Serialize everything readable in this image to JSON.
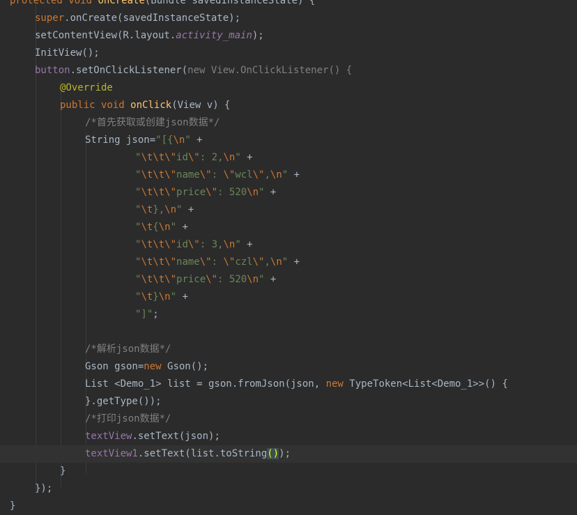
{
  "colors": {
    "background": "#2b2b2b",
    "current_line": "#323232",
    "keyword": "#cc7832",
    "method": "#ffc66d",
    "field": "#9876aa",
    "string": "#6a8759",
    "number": "#6897bb",
    "comment": "#808080",
    "annotation": "#bbb529",
    "plain": "#a9b7c6"
  },
  "code": {
    "lines": [
      {
        "indent": 0,
        "tokens": [
          {
            "t": "protected",
            "c": "kw"
          },
          {
            "t": " "
          },
          {
            "t": "void",
            "c": "kw"
          },
          {
            "t": " "
          },
          {
            "t": "onCreate",
            "c": "fn"
          },
          {
            "t": "(Bundle savedInstanceState) {"
          }
        ]
      },
      {
        "indent": 1,
        "tokens": [
          {
            "t": "super",
            "c": "kw"
          },
          {
            "t": ".onCreate(savedInstanceState);"
          }
        ]
      },
      {
        "indent": 1,
        "tokens": [
          {
            "t": "setContentView(R.layout."
          },
          {
            "t": "activity_main",
            "c": "it"
          },
          {
            "t": ");"
          }
        ]
      },
      {
        "indent": 1,
        "tokens": [
          {
            "t": "InitView();"
          }
        ]
      },
      {
        "indent": 1,
        "tokens": [
          {
            "t": "button",
            "c": "fld"
          },
          {
            "t": ".setOnClickListener("
          },
          {
            "t": "new",
            "c": "dim"
          },
          {
            "t": " View.OnClickListener() {",
            "c": "dim"
          }
        ]
      },
      {
        "indent": 2,
        "tokens": [
          {
            "t": "@Override",
            "c": "ann"
          }
        ]
      },
      {
        "indent": 2,
        "tokens": [
          {
            "t": "public",
            "c": "kw"
          },
          {
            "t": " "
          },
          {
            "t": "void",
            "c": "kw"
          },
          {
            "t": " "
          },
          {
            "t": "onClick",
            "c": "fn"
          },
          {
            "t": "(View v) {"
          }
        ]
      },
      {
        "indent": 3,
        "tokens": [
          {
            "t": "/*首先获取或创建json数据*/",
            "c": "cmt"
          }
        ]
      },
      {
        "indent": 3,
        "tokens": [
          {
            "t": "String json="
          },
          {
            "t": "\"[{",
            "c": "str"
          },
          {
            "t": "\\n",
            "c": "esc"
          },
          {
            "t": "\"",
            "c": "str"
          },
          {
            "t": " +"
          }
        ]
      },
      {
        "indent": 5,
        "tokens": [
          {
            "t": "\"",
            "c": "str"
          },
          {
            "t": "\\t\\t\\\"",
            "c": "esc"
          },
          {
            "t": "id",
            "c": "str"
          },
          {
            "t": "\\\"",
            "c": "esc"
          },
          {
            "t": ": 2,",
            "c": "str"
          },
          {
            "t": "\\n",
            "c": "esc"
          },
          {
            "t": "\"",
            "c": "str"
          },
          {
            "t": " +"
          }
        ]
      },
      {
        "indent": 5,
        "tokens": [
          {
            "t": "\"",
            "c": "str"
          },
          {
            "t": "\\t\\t\\\"",
            "c": "esc"
          },
          {
            "t": "name",
            "c": "str"
          },
          {
            "t": "\\\"",
            "c": "esc"
          },
          {
            "t": ": ",
            "c": "str"
          },
          {
            "t": "\\\"",
            "c": "esc"
          },
          {
            "t": "wcl",
            "c": "str"
          },
          {
            "t": "\\\"",
            "c": "esc"
          },
          {
            "t": ",",
            "c": "str"
          },
          {
            "t": "\\n",
            "c": "esc"
          },
          {
            "t": "\"",
            "c": "str"
          },
          {
            "t": " +"
          }
        ]
      },
      {
        "indent": 5,
        "tokens": [
          {
            "t": "\"",
            "c": "str"
          },
          {
            "t": "\\t\\t\\\"",
            "c": "esc"
          },
          {
            "t": "price",
            "c": "str"
          },
          {
            "t": "\\\"",
            "c": "esc"
          },
          {
            "t": ": 520",
            "c": "str"
          },
          {
            "t": "\\n",
            "c": "esc"
          },
          {
            "t": "\"",
            "c": "str"
          },
          {
            "t": " +"
          }
        ]
      },
      {
        "indent": 5,
        "tokens": [
          {
            "t": "\"",
            "c": "str"
          },
          {
            "t": "\\t",
            "c": "esc"
          },
          {
            "t": "},",
            "c": "str"
          },
          {
            "t": "\\n",
            "c": "esc"
          },
          {
            "t": "\"",
            "c": "str"
          },
          {
            "t": " +"
          }
        ]
      },
      {
        "indent": 5,
        "tokens": [
          {
            "t": "\"",
            "c": "str"
          },
          {
            "t": "\\t",
            "c": "esc"
          },
          {
            "t": "{",
            "c": "str"
          },
          {
            "t": "\\n",
            "c": "esc"
          },
          {
            "t": "\"",
            "c": "str"
          },
          {
            "t": " +"
          }
        ]
      },
      {
        "indent": 5,
        "tokens": [
          {
            "t": "\"",
            "c": "str"
          },
          {
            "t": "\\t\\t\\\"",
            "c": "esc"
          },
          {
            "t": "id",
            "c": "str"
          },
          {
            "t": "\\\"",
            "c": "esc"
          },
          {
            "t": ": 3,",
            "c": "str"
          },
          {
            "t": "\\n",
            "c": "esc"
          },
          {
            "t": "\"",
            "c": "str"
          },
          {
            "t": " +"
          }
        ]
      },
      {
        "indent": 5,
        "tokens": [
          {
            "t": "\"",
            "c": "str"
          },
          {
            "t": "\\t\\t\\\"",
            "c": "esc"
          },
          {
            "t": "name",
            "c": "str"
          },
          {
            "t": "\\\"",
            "c": "esc"
          },
          {
            "t": ": ",
            "c": "str"
          },
          {
            "t": "\\\"",
            "c": "esc"
          },
          {
            "t": "czl",
            "c": "str"
          },
          {
            "t": "\\\"",
            "c": "esc"
          },
          {
            "t": ",",
            "c": "str"
          },
          {
            "t": "\\n",
            "c": "esc"
          },
          {
            "t": "\"",
            "c": "str"
          },
          {
            "t": " +"
          }
        ]
      },
      {
        "indent": 5,
        "tokens": [
          {
            "t": "\"",
            "c": "str"
          },
          {
            "t": "\\t\\t\\\"",
            "c": "esc"
          },
          {
            "t": "price",
            "c": "str"
          },
          {
            "t": "\\\"",
            "c": "esc"
          },
          {
            "t": ": 520",
            "c": "str"
          },
          {
            "t": "\\n",
            "c": "esc"
          },
          {
            "t": "\"",
            "c": "str"
          },
          {
            "t": " +"
          }
        ]
      },
      {
        "indent": 5,
        "tokens": [
          {
            "t": "\"",
            "c": "str"
          },
          {
            "t": "\\t",
            "c": "esc"
          },
          {
            "t": "}",
            "c": "str"
          },
          {
            "t": "\\n",
            "c": "esc"
          },
          {
            "t": "\"",
            "c": "str"
          },
          {
            "t": " +"
          }
        ]
      },
      {
        "indent": 5,
        "tokens": [
          {
            "t": "\"]\"",
            "c": "str"
          },
          {
            "t": ";"
          }
        ]
      },
      {
        "indent": 0,
        "tokens": []
      },
      {
        "indent": 3,
        "tokens": [
          {
            "t": "/*解析json数据*/",
            "c": "cmt"
          }
        ]
      },
      {
        "indent": 3,
        "tokens": [
          {
            "t": "Gson gson="
          },
          {
            "t": "new",
            "c": "kw"
          },
          {
            "t": " Gson();"
          }
        ]
      },
      {
        "indent": 3,
        "tokens": [
          {
            "t": "List <Demo_1> list = gson.fromJson(json, "
          },
          {
            "t": "new",
            "c": "kw"
          },
          {
            "t": " TypeToken<List<Demo_1>>() {"
          }
        ]
      },
      {
        "indent": 3,
        "tokens": [
          {
            "t": "}.getType());"
          }
        ]
      },
      {
        "indent": 3,
        "tokens": [
          {
            "t": "/*打印json数据*/",
            "c": "cmt"
          }
        ]
      },
      {
        "indent": 3,
        "tokens": [
          {
            "t": "textView",
            "c": "fld"
          },
          {
            "t": ".setText(json);"
          }
        ]
      },
      {
        "indent": 3,
        "current": true,
        "tokens": [
          {
            "t": "textView1",
            "c": "fld"
          },
          {
            "t": ".setText(list.toString"
          },
          {
            "t": "()",
            "c": "brace"
          },
          {
            "t": ");"
          }
        ]
      },
      {
        "indent": 2,
        "tokens": [
          {
            "t": "}"
          }
        ]
      },
      {
        "indent": 1,
        "tokens": [
          {
            "t": "});"
          }
        ]
      },
      {
        "indent": 0,
        "tokens": [
          {
            "t": "}"
          }
        ]
      }
    ]
  }
}
